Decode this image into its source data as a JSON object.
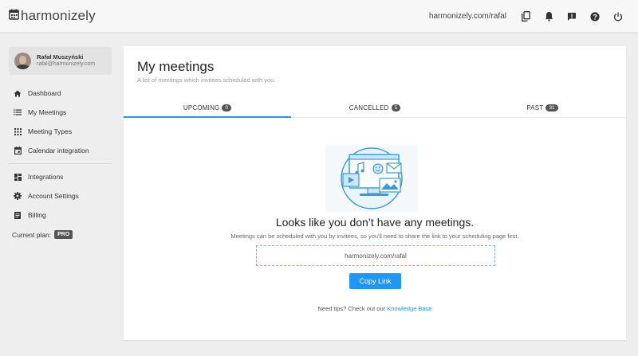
{
  "header": {
    "logo_text": "harmonizely",
    "profile_url": "harmonizely.com/rafal",
    "icons": [
      "calendar-icon",
      "copy-icon",
      "bell-icon",
      "feedback-icon",
      "help-icon",
      "power-icon"
    ]
  },
  "user": {
    "name": "Rafał Muszyński",
    "email": "rafal@harmonizely.com"
  },
  "sidebar": {
    "items": [
      {
        "label": "Dashboard",
        "icon": "home-icon"
      },
      {
        "label": "My Meetings",
        "icon": "list-icon"
      },
      {
        "label": "Meeting Types",
        "icon": "grid-icon"
      },
      {
        "label": "Calendar integration",
        "icon": "calendar-icon"
      },
      {
        "label": "Integrations",
        "icon": "dashboard-icon"
      },
      {
        "label": "Account Settings",
        "icon": "gear-icon"
      },
      {
        "label": "Billing",
        "icon": "receipt-icon"
      }
    ],
    "plan_label": "Current plan:",
    "plan_value": "PRO"
  },
  "main": {
    "title": "My meetings",
    "subtitle": "A list of meetings which invitees scheduled with you.",
    "tabs": [
      {
        "label": "UPCOMING",
        "count": "0"
      },
      {
        "label": "CANCELLED",
        "count": "5"
      },
      {
        "label": "PAST",
        "count": "31"
      }
    ],
    "empty_title": "Looks like you don’t have any meetings.",
    "empty_subtitle": "Meetings can be scheduled with you by invitees, so you'll need to share the link to your scheduling page first.",
    "link_value": "harmonizely.com/rafal",
    "copy_button": "Copy Link",
    "tips_text": "Need tips? Check out our",
    "tips_link": "Knowledge Base"
  },
  "colors": {
    "accent": "#2196f3",
    "tab_underline": "#2b96e6",
    "badge": "#555555",
    "illustration": "#3a9ad9"
  }
}
